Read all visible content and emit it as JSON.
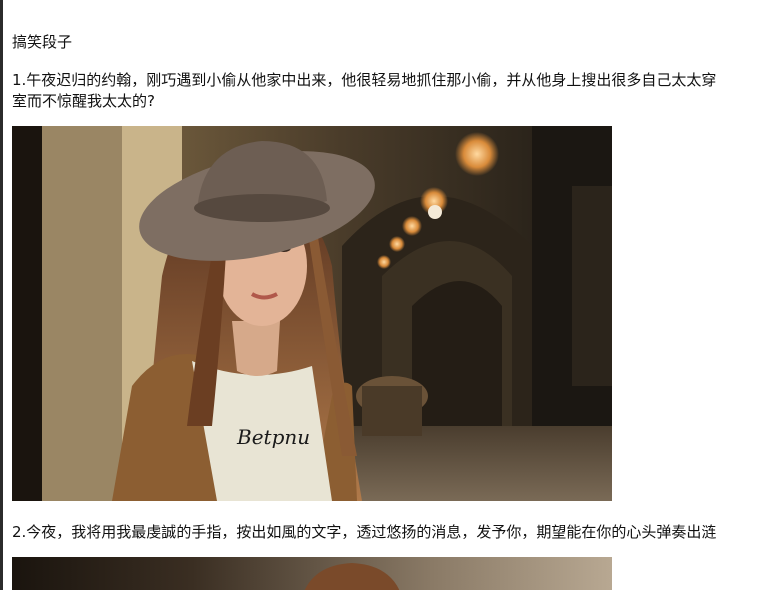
{
  "page": {
    "title": "搞笑段子"
  },
  "jokes": [
    {
      "line1": "1.午夜迟归的约翰，刚巧遇到小偷从他家中出来，他很轻易地抓住那小偷，并从他身上搜出很多自己太太穿",
      "line2": "室而不惊醒我太太的?",
      "image_icon": "photo-of-woman-in-hat",
      "image_text": "Betpnu"
    },
    {
      "line1": "2.今夜，我将用我最虔誠的手指，按出如風的文字，透过悠扬的消息，发予你，期望能在你的心头弹奏出涟",
      "image_icon": "photo-of-woman"
    }
  ],
  "colors": {
    "background": "#ffffff",
    "text": "#111111",
    "photo_warm": "#7a5a3a",
    "photo_dark": "#2a2117"
  }
}
